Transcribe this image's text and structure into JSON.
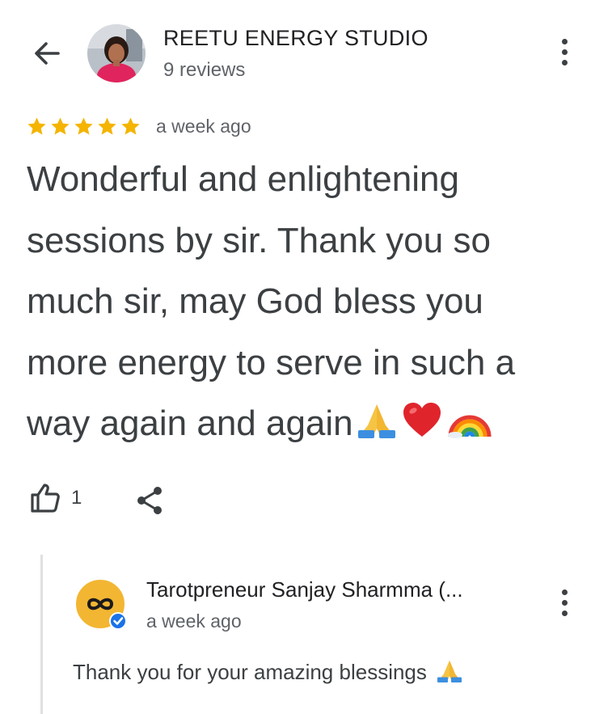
{
  "header": {
    "title": "REETU ENERGY STUDIO",
    "subtitle": "9 reviews",
    "back_icon": "arrow-back-icon",
    "more_icon": "more-vert-icon"
  },
  "review": {
    "rating": 5,
    "date": "a week ago",
    "text": "Wonderful and enlightening\nsessions by sir. Thank you so\nmuch sir, may God bless you\nmore energy to serve in such a\nway again and again",
    "emojis": [
      "folded-hands",
      "red-heart",
      "rainbow"
    ],
    "like_count": "1",
    "like_icon": "thumb-up-icon",
    "share_icon": "share-icon"
  },
  "reply": {
    "owner_name": "Tarotpreneur Sanjay Sharmma (...",
    "date": "a week ago",
    "text": "Thank you for your amazing blessings",
    "emoji": "folded-hands",
    "verified_icon": "verified-badge-icon"
  },
  "colors": {
    "star": "#f4b400",
    "text_primary": "#202124",
    "text_secondary": "#5f6368",
    "verified": "#1a73e8",
    "owner_avatar_bg": "#f2b632"
  }
}
